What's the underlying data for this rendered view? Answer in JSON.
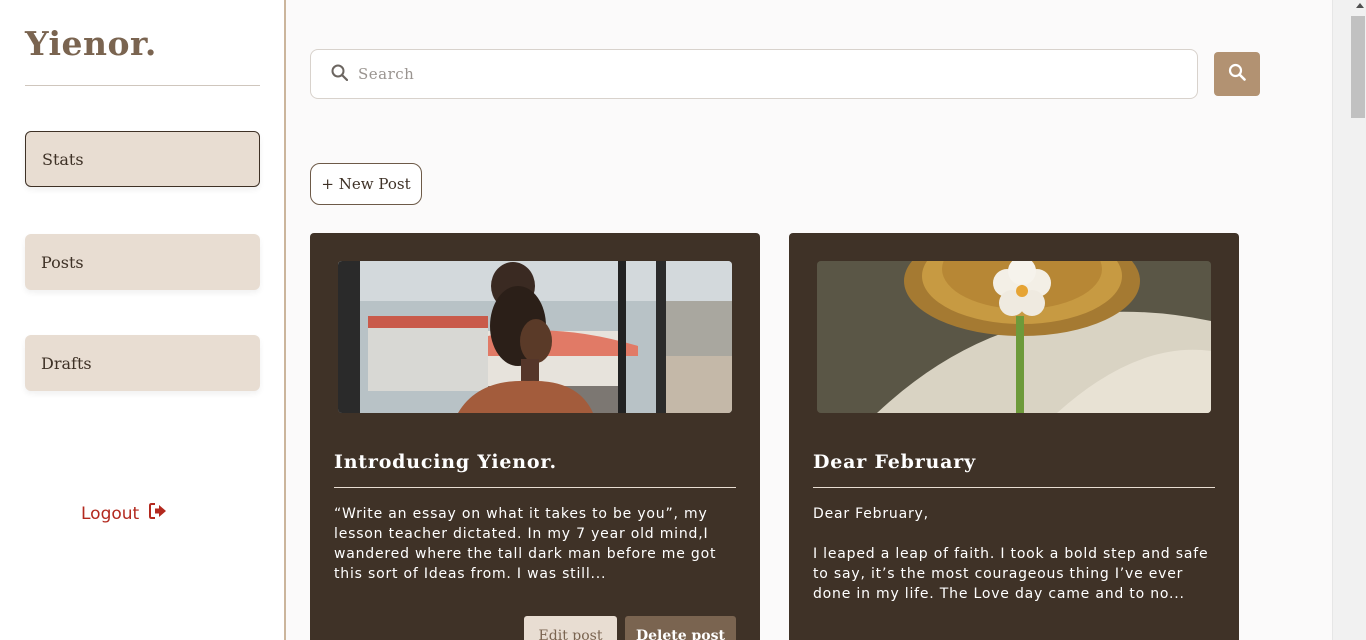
{
  "sidebar": {
    "logo": "Yienor.",
    "nav": [
      {
        "label": "Stats",
        "active": true
      },
      {
        "label": "Posts",
        "active": false
      },
      {
        "label": "Drafts",
        "active": false
      }
    ],
    "logout_label": "Logout"
  },
  "search": {
    "placeholder": "Search"
  },
  "new_post_label": "+ New Post",
  "posts": [
    {
      "title": "Introducing Yienor.",
      "excerpt": "“Write an essay on what it takes to be you”, my lesson teacher dictated. In my 7 year old mind,I wandered where the tall dark man before me got this sort of Ideas from. I was still...",
      "image": "woman-by-window-photo",
      "edit_label": "Edit post",
      "delete_label": "Delete post"
    },
    {
      "title": "Dear February",
      "excerpt": "Dear February,\n\nI leaped a leap of faith. I took a bold step and safe to say, it’s the most courageous thing I’ve ever done in my life. The Love day came and to no...",
      "image": "flower-glass-photo"
    }
  ],
  "colors": {
    "accent": "#b29272",
    "card_bg": "#3f3227",
    "nav_bg": "#e8ddd2",
    "logout": "#b3291e"
  }
}
